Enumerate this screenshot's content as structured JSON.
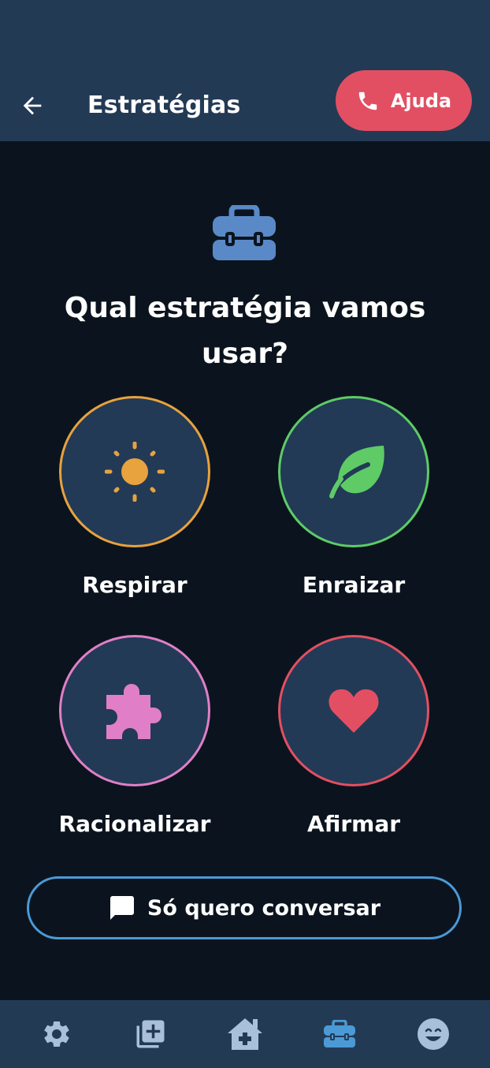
{
  "header": {
    "title": "Estratégias",
    "help_label": "Ajuda",
    "icons": {
      "back": "arrow-left-icon",
      "help": "phone-icon"
    }
  },
  "main": {
    "hero_icon": "toolbox-icon",
    "question": "Qual estratégia vamos usar?",
    "strategies": [
      {
        "label": "Respirar",
        "icon": "sun-icon",
        "color": "#e8a23e"
      },
      {
        "label": "Enraizar",
        "icon": "leaf-icon",
        "color": "#5ecb67"
      },
      {
        "label": "Racionalizar",
        "icon": "puzzle-icon",
        "color": "#e07fc7"
      },
      {
        "label": "Afirmar",
        "icon": "heart-icon",
        "color": "#e34f62"
      }
    ],
    "talk_button": {
      "label": "Só quero conversar",
      "icon": "chat-icon",
      "border_color": "#4b9ad6"
    }
  },
  "bottom_nav": {
    "items": [
      {
        "icon": "gear-icon",
        "active": false
      },
      {
        "icon": "add-collection-icon",
        "active": false
      },
      {
        "icon": "home-medical-icon",
        "active": false
      },
      {
        "icon": "toolbox-icon",
        "active": true
      },
      {
        "icon": "smile-icon",
        "active": false
      }
    ]
  },
  "colors": {
    "background": "#0b141e",
    "header": "#233a55",
    "help": "#e34f62",
    "accent": "#4b9ad6",
    "nav_inactive": "#a9c0db"
  }
}
